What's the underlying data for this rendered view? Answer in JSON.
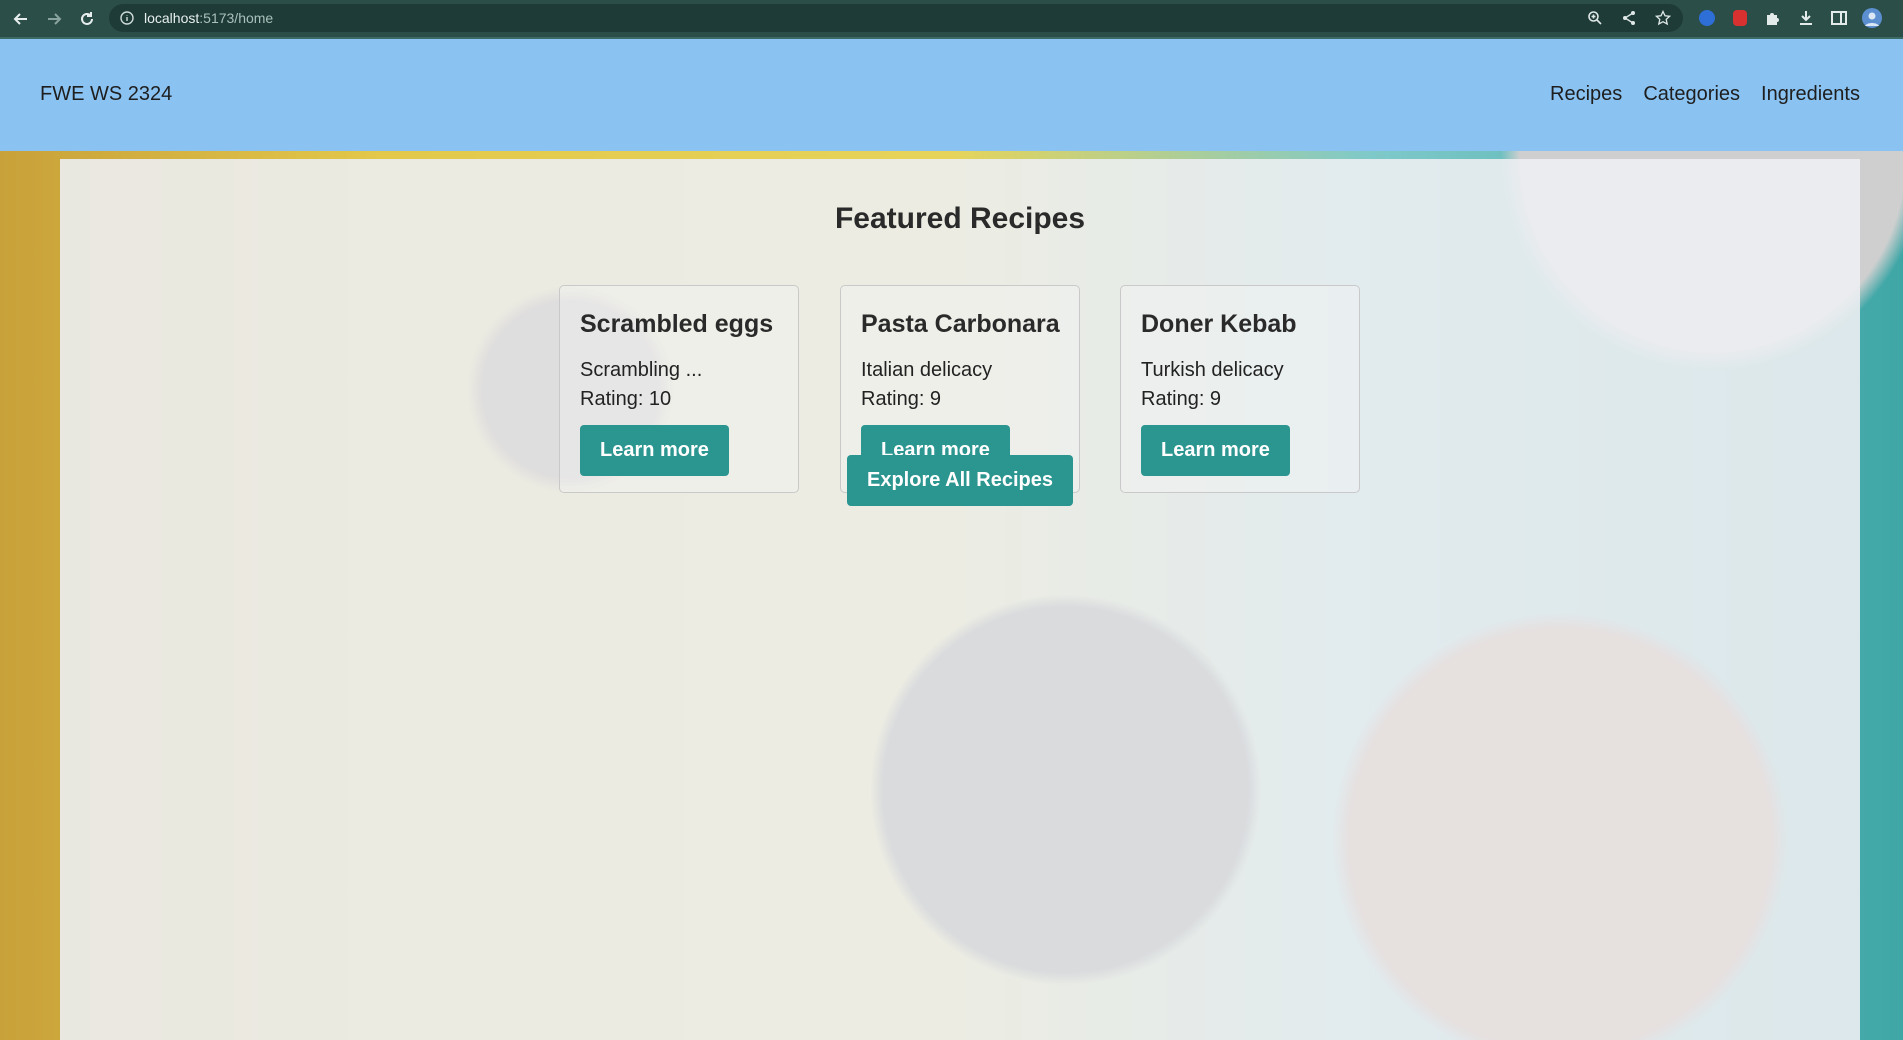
{
  "browser": {
    "url_host": "localhost",
    "url_path": ":5173/home"
  },
  "header": {
    "brand": "FWE WS 2324",
    "nav": [
      {
        "label": "Recipes"
      },
      {
        "label": "Categories"
      },
      {
        "label": "Ingredients"
      }
    ]
  },
  "main": {
    "title": "Featured Recipes",
    "recipes": [
      {
        "name": "Scrambled eggs",
        "description": "Scrambling ...",
        "rating": "Rating: 10",
        "button": "Learn more"
      },
      {
        "name": "Pasta Carbonara",
        "description": "Italian delicacy",
        "rating": "Rating: 9",
        "button": "Learn more"
      },
      {
        "name": "Doner Kebab",
        "description": "Turkish delicacy",
        "rating": "Rating: 9",
        "button": "Learn more"
      }
    ],
    "explore_button": "Explore All Recipes"
  },
  "colors": {
    "header_bg": "#8ac3f2",
    "button_bg": "#2b9590",
    "chrome_bg": "#2b4e49"
  }
}
